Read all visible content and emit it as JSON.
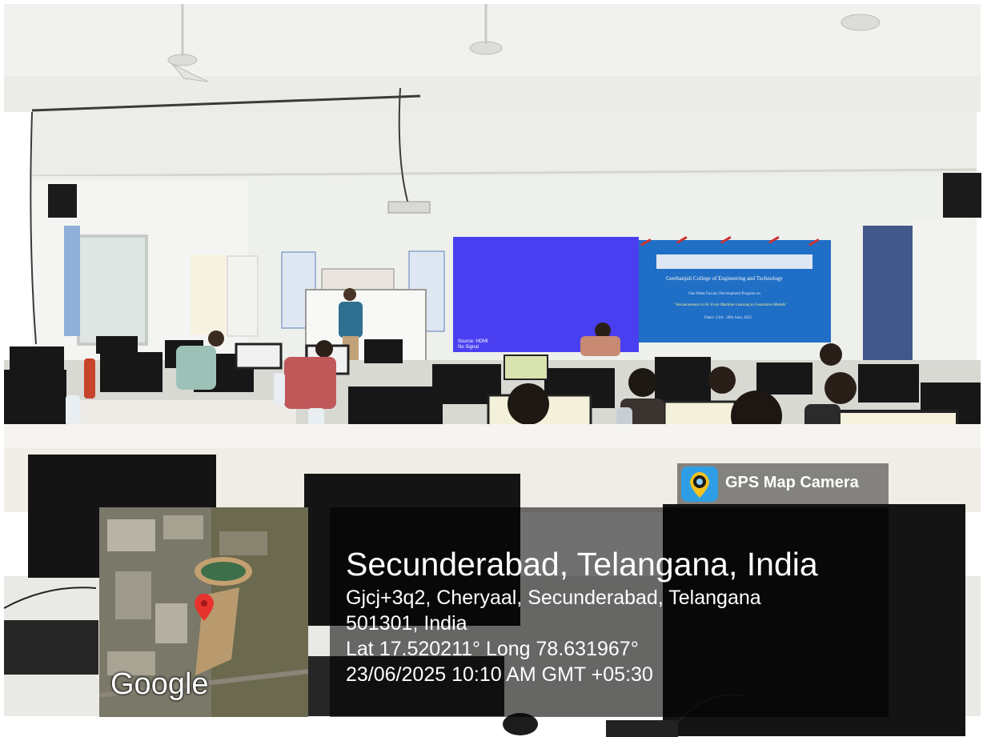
{
  "watermark": {
    "app_name": "GPS Map Camera",
    "logo": "Google",
    "city": "Secunderabad, Telangana, India",
    "address_line1": "Gjcj+3q2, Cheryaal, Secunderabad, Telangana",
    "address_line2": "501301, India",
    "coordinates": "Lat 17.520211° Long 78.631967°",
    "datetime": "23/06/2025 10:10 AM GMT +05:30"
  },
  "scene": {
    "projector_text": "Source: HDMI No Signal",
    "banner_title": "Geethanjali College of Engineering and Technology",
    "banner_subtitle": "One Week Faculty Development Program on",
    "banner_topic": "\"Advancements in AI: From Machine Learning to Generative Models\"",
    "banner_dates": "Dates: 23rd - 28th June, 2025"
  },
  "colors": {
    "wall": "#eef0ec",
    "ceiling": "#f1f1ee",
    "projection": "#4a3ff0",
    "banner": "#1f6fc6",
    "overlay": "#000000",
    "map_marker": "#e8322d"
  }
}
